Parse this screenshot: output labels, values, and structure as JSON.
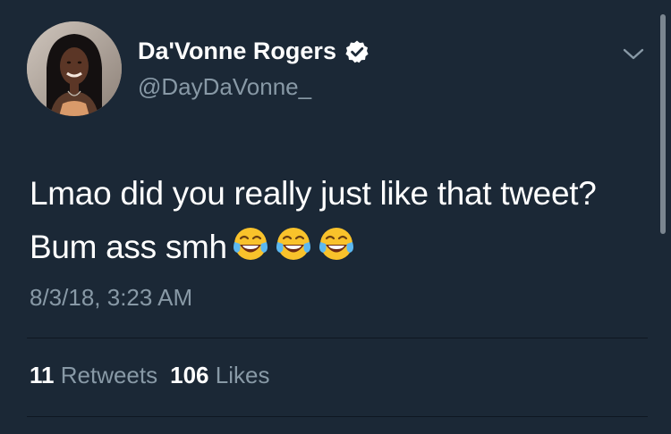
{
  "user": {
    "display_name": "Da'Vonne Rogers",
    "handle": "@DayDaVonne_",
    "verified": true
  },
  "tweet": {
    "text": "Lmao did you really just like that tweet? Bum ass smh",
    "emojis": [
      "face-with-tears-of-joy",
      "face-with-tears-of-joy",
      "face-with-tears-of-joy"
    ],
    "timestamp": "8/3/18, 3:23 AM"
  },
  "stats": {
    "retweets_count": "11",
    "retweets_label": "Retweets",
    "likes_count": "106",
    "likes_label": "Likes"
  },
  "icons": {
    "verified": "verified-badge-icon",
    "menu": "chevron-down-icon"
  },
  "colors": {
    "background": "#1b2836",
    "secondary_text": "#8899a6",
    "primary_text": "#ffffff"
  }
}
